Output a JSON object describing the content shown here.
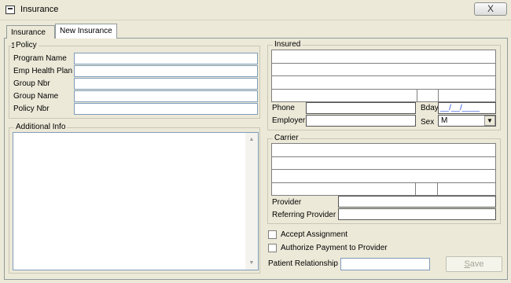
{
  "window": {
    "title": "Insurance",
    "close": "X"
  },
  "tabs": [
    {
      "label": "Insurance 1"
    },
    {
      "label": "New Insurance"
    }
  ],
  "policy": {
    "legend": "Policy",
    "fields": [
      {
        "label": "Program Name",
        "value": ""
      },
      {
        "label": "Emp Health Plan",
        "value": ""
      },
      {
        "label": "Group Nbr",
        "value": ""
      },
      {
        "label": "Group Name",
        "value": ""
      },
      {
        "label": "Policy Nbr",
        "value": ""
      }
    ]
  },
  "additional_info": {
    "legend": "Additional Info",
    "value": "",
    "scroll_up": "▲",
    "scroll_down": "▼"
  },
  "insured": {
    "legend": "Insured",
    "phone_label": "Phone",
    "employer_label": "Employer",
    "bday_label": "Bday",
    "bday_value": "__/__/____",
    "sex_label": "Sex",
    "sex_value": "M",
    "sex_arrow": "▼"
  },
  "carrier": {
    "legend": "Carrier",
    "provider_label": "Provider",
    "referring_label": "Referring Provider"
  },
  "options": {
    "accept_assignment": "Accept Assignment",
    "authorize_payment": "Authorize Payment to Provider",
    "patient_relationship_label": "Patient Relationship",
    "patient_relationship_value": ""
  },
  "save_button": {
    "label": "Save",
    "access_key": "S",
    "rest": "ave"
  }
}
